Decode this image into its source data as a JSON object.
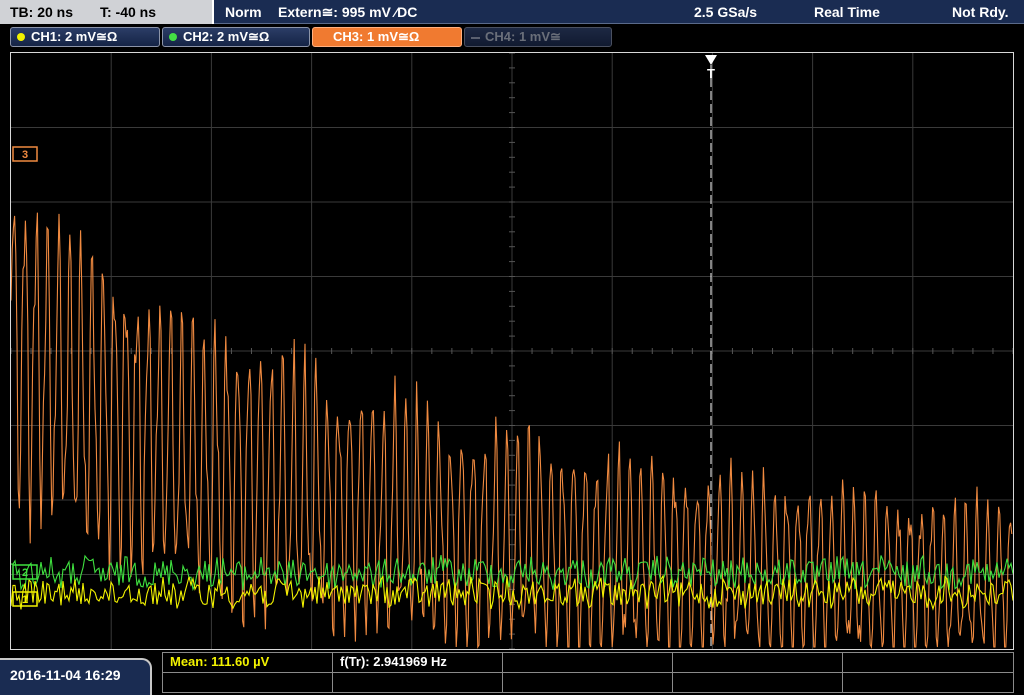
{
  "topbar": {
    "timebase": "TB: 20 ns",
    "trigger_offset": "T: -40 ns",
    "mode": "Norm",
    "trigger_source": "Extern≅: 995 mV ⁄DC",
    "sample_rate": "2.5 GSa/s",
    "acq_mode": "Real Time",
    "status": "Not Rdy."
  },
  "channels": [
    {
      "label": "CH1: 2 mV≅Ω",
      "color": "#f2f200",
      "state": "on"
    },
    {
      "label": "CH2: 2 mV≅Ω",
      "color": "#44e044",
      "state": "on"
    },
    {
      "label": "CH3: 1 mV≅Ω",
      "color": "#ffffff",
      "state": "selected"
    },
    {
      "label": "CH4: 1 mV≅",
      "color": "#6a6f7a",
      "state": "off"
    }
  ],
  "trigger_marker": "T",
  "markers": {
    "ch3": "3",
    "ch2": "2",
    "ch1": "1"
  },
  "measurements": {
    "mean": "Mean: 111.60 µV",
    "freq": "f(Tr): 2.941969 Hz"
  },
  "datetime": "2016-11-04 16:29",
  "colors": {
    "ch1": "#f2f200",
    "ch2": "#3fe03f",
    "ch3": "#f08a40",
    "grid": "#3a3a3a",
    "header": "#1a2c52"
  }
}
